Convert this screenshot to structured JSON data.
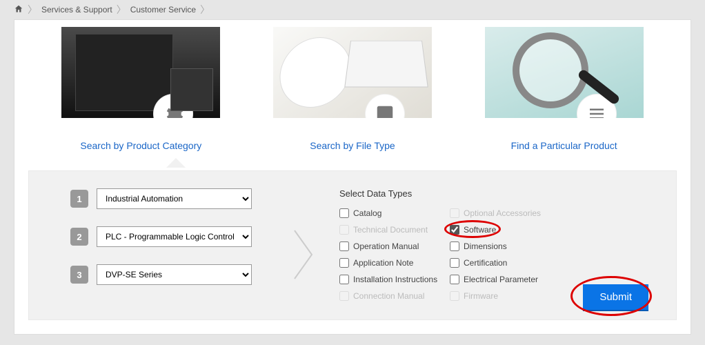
{
  "breadcrumb": {
    "items": [
      "Services & Support",
      "Customer Service"
    ]
  },
  "cards": {
    "product": {
      "title": "Search by Product Category"
    },
    "file": {
      "title": "Search by File Type"
    },
    "find": {
      "title": "Find a Particular Product"
    }
  },
  "steps": {
    "s1": {
      "num": "1",
      "value": "Industrial Automation"
    },
    "s2": {
      "num": "2",
      "value": "PLC - Programmable Logic Control"
    },
    "s3": {
      "num": "3",
      "value": "DVP-SE Series"
    }
  },
  "dataTypes": {
    "heading": "Select Data Types",
    "items": {
      "catalog": {
        "label": "Catalog",
        "checked": false,
        "disabled": false
      },
      "optional": {
        "label": "Optional Accessories",
        "checked": false,
        "disabled": true
      },
      "techdoc": {
        "label": "Technical Document",
        "checked": false,
        "disabled": true
      },
      "software": {
        "label": "Software",
        "checked": true,
        "disabled": false
      },
      "opman": {
        "label": "Operation Manual",
        "checked": false,
        "disabled": false
      },
      "dims": {
        "label": "Dimensions",
        "checked": false,
        "disabled": false
      },
      "appnote": {
        "label": "Application Note",
        "checked": false,
        "disabled": false
      },
      "cert": {
        "label": "Certification",
        "checked": false,
        "disabled": false
      },
      "install": {
        "label": "Installation Instructions",
        "checked": false,
        "disabled": false
      },
      "elec": {
        "label": "Electrical Parameter",
        "checked": false,
        "disabled": false
      },
      "connman": {
        "label": "Connection Manual",
        "checked": false,
        "disabled": true
      },
      "firmware": {
        "label": "Firmware",
        "checked": false,
        "disabled": true
      }
    }
  },
  "submit": {
    "label": "Submit"
  }
}
